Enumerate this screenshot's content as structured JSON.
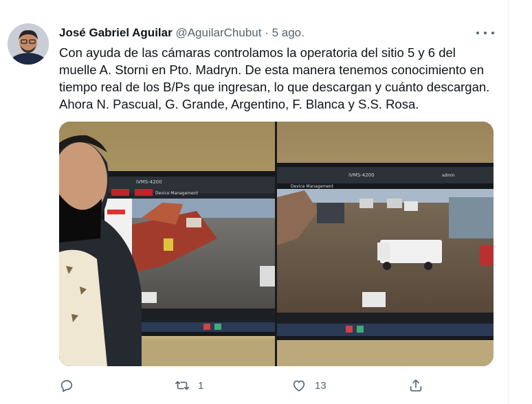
{
  "tweet": {
    "author_name": "José Gabriel Aguilar",
    "handle": "@AguilarChubut",
    "separator": "·",
    "time": "5 ago.",
    "text_lines": [
      "Con ayuda de las cámaras controlamos la operatoria del sitio 5 y 6 del",
      "muelle A. Storni en Pto. Madryn. De esta manera tenemos conocimiento en",
      "tiempo real de los B/Ps que ingresan, lo que descargan y cuánto descargan.",
      "Ahora N. Pascual, G. Grande, Argentino, F. Blanca y S.S. Rosa."
    ],
    "more_icon": "more-horizontal-icon",
    "photo_left": {
      "app_title": "iVMS-4200",
      "menu": "Device Management"
    },
    "photo_right": {
      "app_title": "iVMS-4200",
      "menu": "Device Management",
      "user": "admin"
    },
    "actions": {
      "reply": {
        "icon": "reply-icon",
        "count": ""
      },
      "retweet": {
        "icon": "retweet-icon",
        "count": "1"
      },
      "like": {
        "icon": "heart-icon",
        "count": "13"
      },
      "share": {
        "icon": "share-icon",
        "count": ""
      }
    }
  },
  "colors": {
    "text_primary": "#0f1419",
    "text_secondary": "#536471",
    "divider": "#eff3f4"
  }
}
